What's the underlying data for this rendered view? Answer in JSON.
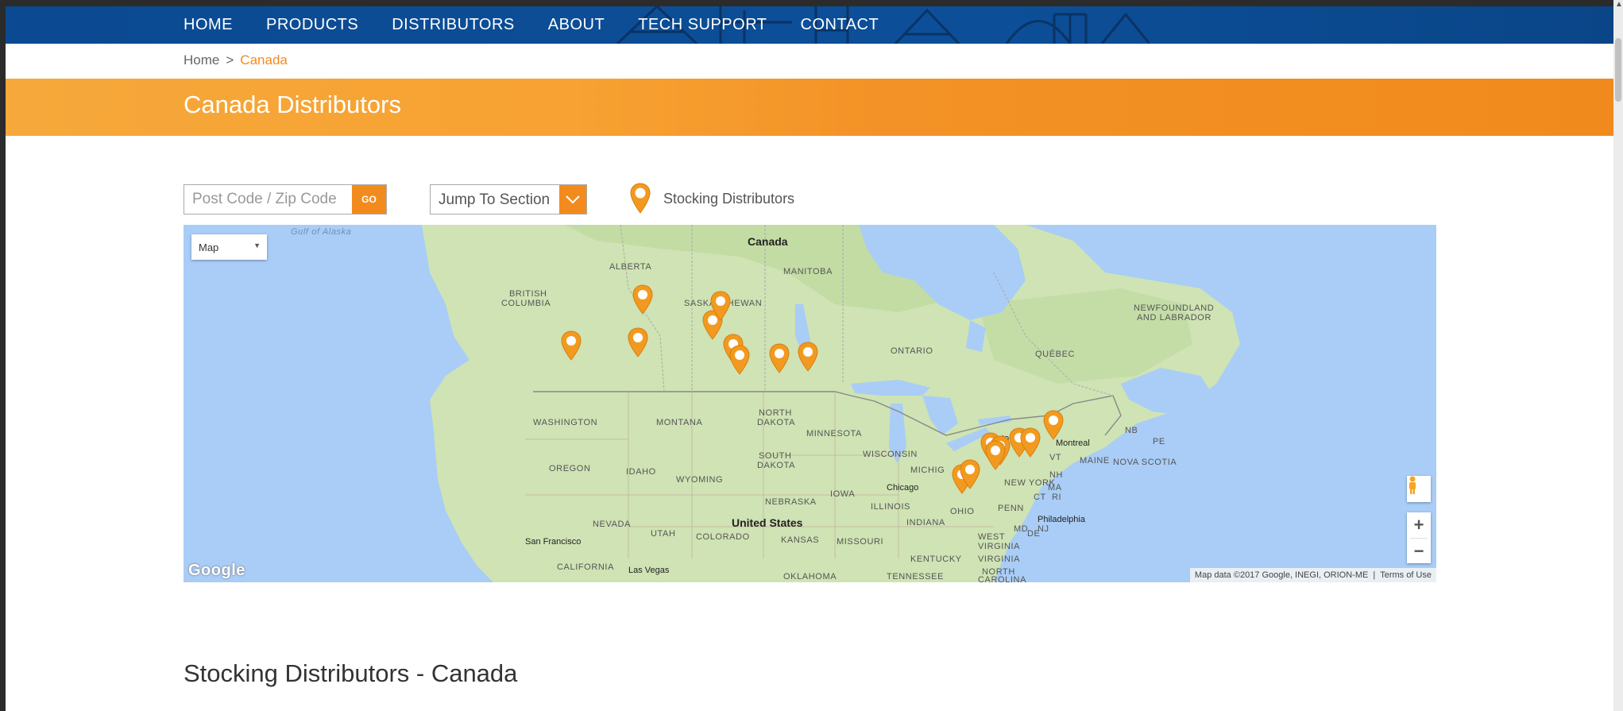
{
  "nav": {
    "items": [
      "HOME",
      "PRODUCTS",
      "DISTRIBUTORS",
      "ABOUT",
      "TECH SUPPORT",
      "CONTACT"
    ]
  },
  "breadcrumb": {
    "home": "Home",
    "separator": ">",
    "current": "Canada"
  },
  "banner": {
    "title": "Canada Distributors"
  },
  "search": {
    "placeholder": "Post Code / Zip Code",
    "go_label": "GO"
  },
  "jump": {
    "label": "Jump To Section"
  },
  "legend": {
    "label": "Stocking Distributors",
    "icon": "map-pin-icon"
  },
  "map": {
    "type_label": "Map",
    "google_logo": "Google",
    "attribution": "Map data ©2017 Google, INEGI, ORION-ME",
    "terms": "Terms of Use",
    "zoom_in": "+",
    "zoom_out": "−",
    "labels": {
      "canada": "Canada",
      "alberta": "ALBERTA",
      "manitoba": "MANITOBA",
      "british_columbia_1": "BRITISH",
      "british_columbia_2": "COLUMBIA",
      "saskatchewan": "SASKATCHEWAN",
      "ontario": "ONTARIO",
      "quebec": "QUÉBEC",
      "newfoundland_1": "NEWFOUNDLAND",
      "newfoundland_2": "AND LABRADOR",
      "washington": "WASHINGTON",
      "montana": "MONTANA",
      "north_dakota_1": "NORTH",
      "north_dakota_2": "DAKOTA",
      "minnesota": "MINNESOTA",
      "oregon": "OREGON",
      "idaho": "IDAHO",
      "south_dakota_1": "SOUTH",
      "south_dakota_2": "DAKOTA",
      "wyoming": "WYOMING",
      "wisconsin": "WISCONSIN",
      "michigan": "MICHIG",
      "iowa": "IOWA",
      "nebraska": "NEBRASKA",
      "illinois": "ILLINOIS",
      "chicago": "Chicago",
      "nevada": "NEVADA",
      "utah": "UTAH",
      "colorado": "COLORADO",
      "kansas": "KANSAS",
      "missouri": "MISSOURI",
      "indiana": "INDIANA",
      "ohio": "OHIO",
      "penn": "PENN",
      "new_york": "NEW YORK",
      "united_states": "United States",
      "san_francisco": "San Francisco",
      "california": "CALIFORNIA",
      "las_vegas": "Las Vegas",
      "oklahoma": "OKLAHOMA",
      "tennessee": "TENNESSEE",
      "kentucky": "KENTUCKY",
      "west_virginia_1": "WEST",
      "west_virginia_2": "VIRGINIA",
      "virginia": "VIRGINIA",
      "north_carolina_1": "NORTH",
      "north_carolina_2": "CAROLINA",
      "montreal": "Montreal",
      "maine": "MAINE",
      "nova_scotia": "NOVA SCOTIA",
      "nb": "NB",
      "pe": "PE",
      "vt": "VT",
      "nh": "NH",
      "ma": "MA",
      "ct": "CT",
      "ri": "RI",
      "md": "MD",
      "de": "DE",
      "nj": "NJ",
      "philadelphia": "Philadelphia",
      "toronto": "to",
      "gulf": "Gulf of Alaska"
    }
  },
  "section": {
    "title": "Stocking Distributors - Canada"
  },
  "colors": {
    "nav_blue": "#0c4f98",
    "accent_orange": "#f28b1e",
    "map_water": "#a9cdf6",
    "map_land": "#cfe3b4"
  }
}
